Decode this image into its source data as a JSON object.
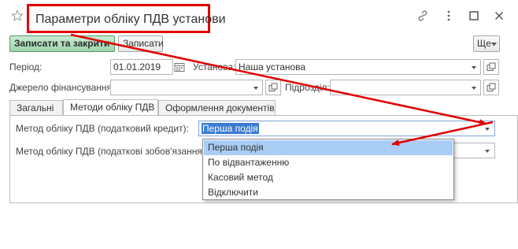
{
  "window": {
    "title": "Параметри обліку ПДВ установи"
  },
  "toolbar": {
    "save_close_label": "Записати та закрити",
    "save_label": "Записати",
    "more_label": "Ще"
  },
  "fields": {
    "period_label": "Період:",
    "period_value": "01.01.2019",
    "institution_label": "Установа:",
    "institution_value": "Наша установа",
    "funding_label": "Джерело фінансування:",
    "funding_value": "",
    "department_label": "Підрозділ:",
    "department_value": ""
  },
  "tabs": [
    {
      "label": "Загальні"
    },
    {
      "label": "Методи обліку ПДВ"
    },
    {
      "label": "Оформлення документів"
    }
  ],
  "methods": {
    "tax_credit_label": "Метод обліку ПДВ (податковий кредит):",
    "tax_credit_value": "Перша подія",
    "tax_liability_label": "Метод обліку ПДВ (податкові зобов'язання):"
  },
  "dropdown_options": [
    {
      "label": "Перша подія",
      "selected": true
    },
    {
      "label": "По відвантаженню",
      "selected": false
    },
    {
      "label": "Касовий метод",
      "selected": false
    },
    {
      "label": "Відключити",
      "selected": false
    }
  ],
  "colors": {
    "annotation_red": "#e00000",
    "primary_button": "#9dd4ad",
    "selection": "#3a7bd5",
    "dropdown_highlight": "#a9cdf5"
  },
  "icons": [
    "star-icon",
    "link-icon",
    "more-vertical-icon",
    "maximize-icon",
    "close-icon",
    "calendar-icon",
    "open-icon",
    "chevron-down-icon"
  ]
}
